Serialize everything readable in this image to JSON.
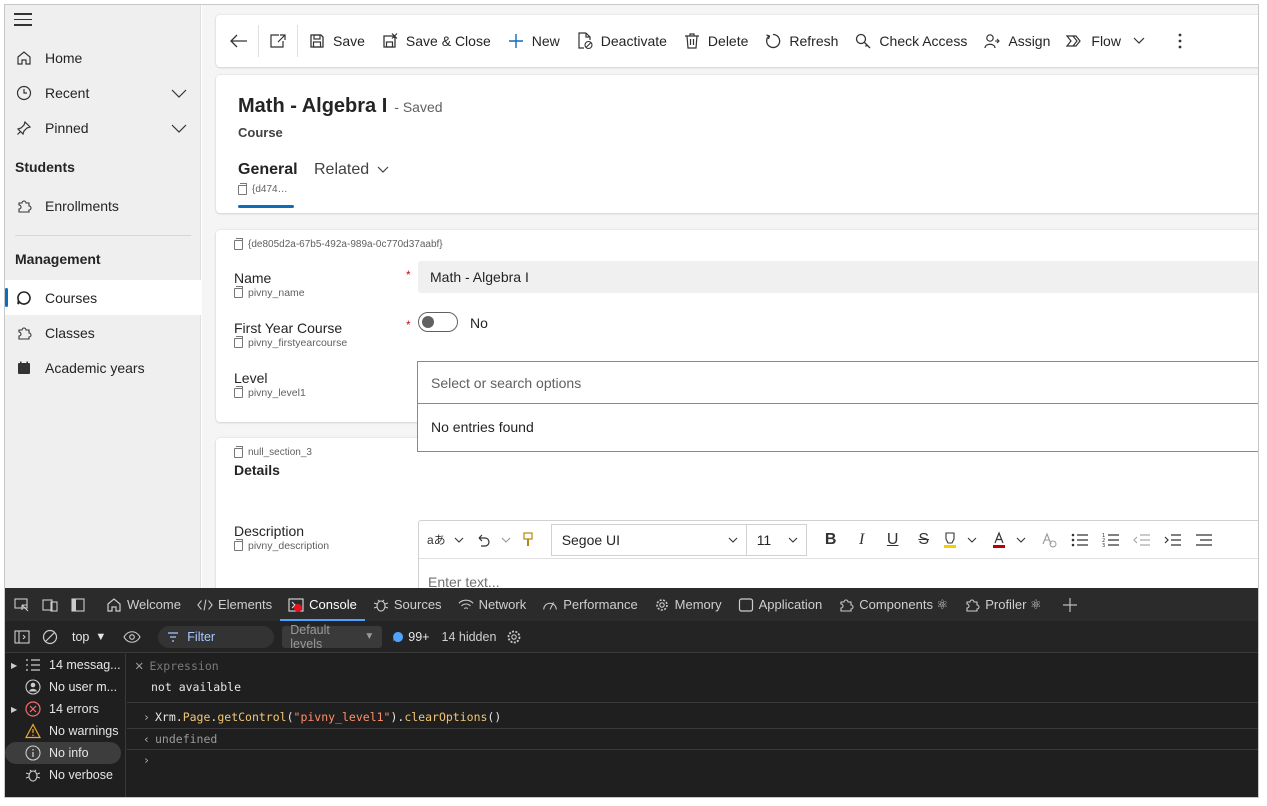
{
  "sidebar": {
    "items": [
      {
        "label": "Home"
      },
      {
        "label": "Recent"
      },
      {
        "label": "Pinned"
      }
    ],
    "groups": [
      {
        "title": "Students",
        "items": [
          {
            "label": "Enrollments"
          }
        ]
      },
      {
        "title": "Management",
        "items": [
          {
            "label": "Courses"
          },
          {
            "label": "Classes"
          },
          {
            "label": "Academic years"
          }
        ]
      }
    ]
  },
  "command_bar": {
    "save": "Save",
    "save_close": "Save & Close",
    "new": "New",
    "deactivate": "Deactivate",
    "delete": "Delete",
    "refresh": "Refresh",
    "check_access": "Check Access",
    "assign": "Assign",
    "flow": "Flow"
  },
  "record": {
    "title": "Math - Algebra I",
    "status": "- Saved",
    "entity": "Course",
    "tabs": {
      "general": "General",
      "general_id": "{d474…",
      "related": "Related"
    }
  },
  "section1": {
    "id": "{de805d2a-67b5-492a-989a-0c770d37aabf}",
    "fields": {
      "name": {
        "label": "Name",
        "logical": "pivny_name",
        "value": "Math - Algebra I",
        "required": "*"
      },
      "first_year": {
        "label": "First Year Course",
        "logical": "pivny_firstyearcourse",
        "value": "No",
        "required": "*"
      },
      "level": {
        "label": "Level",
        "logical": "pivny_level1"
      }
    }
  },
  "lookup": {
    "placeholder": "Select or search options",
    "empty_text": "No entries found"
  },
  "section2": {
    "id": "null_section_3",
    "title": "Details",
    "description": {
      "label": "Description",
      "logical": "pivny_description"
    },
    "rte": {
      "font": "Segoe UI",
      "size": "11",
      "placeholder": "Enter text..."
    }
  },
  "devtools": {
    "tabs": [
      {
        "label": "Welcome"
      },
      {
        "label": "Elements"
      },
      {
        "label": "Console"
      },
      {
        "label": "Sources"
      },
      {
        "label": "Network"
      },
      {
        "label": "Performance"
      },
      {
        "label": "Memory"
      },
      {
        "label": "Application"
      },
      {
        "label": "Components ⚛"
      },
      {
        "label": "Profiler ⚛"
      }
    ],
    "context": "top",
    "filter": "Filter",
    "levels": "Default levels",
    "issues": "99+",
    "hidden": "14 hidden",
    "sidebar": [
      {
        "label": "14 messag..."
      },
      {
        "label": "No user m..."
      },
      {
        "label": "14 errors"
      },
      {
        "label": "No warnings"
      },
      {
        "label": "No info"
      },
      {
        "label": "No verbose"
      }
    ],
    "console": {
      "expression_header": "Expression",
      "expression_value": "not available",
      "cmd_obj": "Xrm.",
      "cmd_page": "Page",
      "cmd_dot1": ".",
      "cmd_fn1": "getControl",
      "cmd_paren1": "(",
      "cmd_arg": "\"pivny_level1\"",
      "cmd_paren2": ").",
      "cmd_fn2": "clearOptions",
      "cmd_paren3": "()",
      "result": "undefined"
    }
  }
}
